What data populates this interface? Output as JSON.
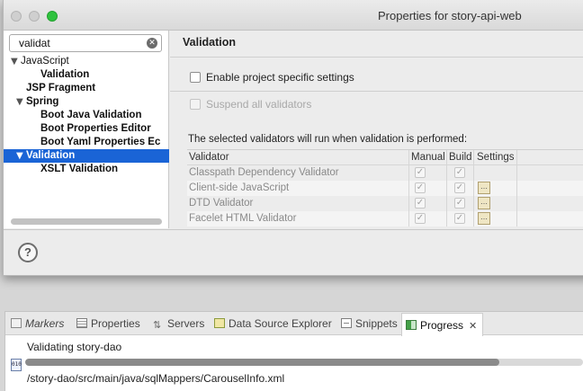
{
  "dialog": {
    "title": "Properties for story-api-web",
    "filter": {
      "value": "validat",
      "placeholder": ""
    },
    "tree": [
      {
        "label": "JavaScript",
        "level": 0,
        "expanded": true,
        "bold": false
      },
      {
        "label": "Validation",
        "level": 1,
        "bold": true
      },
      {
        "label": "JSP Fragment",
        "level": 0,
        "bold": true
      },
      {
        "label": "Spring",
        "level": 0,
        "expanded": true,
        "bold": true
      },
      {
        "label": "Boot Java Validation",
        "level": 1,
        "bold": true
      },
      {
        "label": "Boot Properties Editor",
        "level": 1,
        "bold": true
      },
      {
        "label": "Boot Yaml Properties Ec",
        "level": 1,
        "bold": true
      },
      {
        "label": "Validation",
        "level": 0,
        "expanded": true,
        "bold": true,
        "selected": true
      },
      {
        "label": "XSLT Validation",
        "level": 1,
        "bold": true
      }
    ],
    "page": {
      "title": "Validation",
      "enable_specific": "Enable project specific settings",
      "suspend_all": "Suspend all validators",
      "info": "The selected validators will run when validation is performed:",
      "table": {
        "columns": [
          "Validator",
          "Manual",
          "Build",
          "Settings"
        ],
        "rows": [
          {
            "name": "Classpath Dependency Validator",
            "manual": true,
            "build": true,
            "settings": false
          },
          {
            "name": "Client-side JavaScript",
            "manual": true,
            "build": true,
            "settings": true
          },
          {
            "name": "DTD Validator",
            "manual": true,
            "build": true,
            "settings": true
          },
          {
            "name": "Facelet HTML Validator",
            "manual": true,
            "build": true,
            "settings": true
          }
        ]
      }
    },
    "help_label": "?"
  },
  "views": {
    "tabs": [
      {
        "label": "Markers",
        "icon": "markers-icon"
      },
      {
        "label": "Properties",
        "icon": "properties-icon"
      },
      {
        "label": "Servers",
        "icon": "servers-icon"
      },
      {
        "label": "Data Source Explorer",
        "icon": "data-source-explorer-icon"
      },
      {
        "label": "Snippets",
        "icon": "snippets-icon"
      },
      {
        "label": "Progress",
        "icon": "progress-icon",
        "active": true
      }
    ],
    "progress": {
      "job": "Validating story-dao",
      "detail": "/story-dao/src/main/java/sqlMappers/CarouselInfo.xml",
      "file_icon_text": "010",
      "percent": 85
    }
  },
  "colors": {
    "selection": "#1a64d6",
    "maximize": "#2fc23e"
  }
}
